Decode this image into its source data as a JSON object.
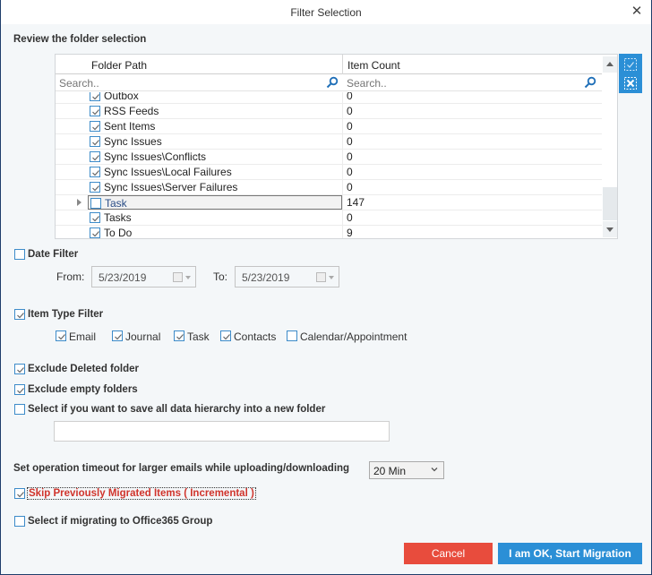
{
  "window": {
    "title": "Filter Selection",
    "close_icon": "close-icon"
  },
  "folder_review": {
    "section_label": "Review the folder selection",
    "columns": [
      "Folder Path",
      "Item Count"
    ],
    "search_placeholders": [
      "Search..",
      "Search.."
    ],
    "rows": [
      {
        "path": "Outbox",
        "count": "0",
        "checked": true,
        "partial": true
      },
      {
        "path": "RSS Feeds",
        "count": "0",
        "checked": true
      },
      {
        "path": "Sent Items",
        "count": "0",
        "checked": true
      },
      {
        "path": "Sync Issues",
        "count": "0",
        "checked": true
      },
      {
        "path": "Sync Issues\\Conflicts",
        "count": "0",
        "checked": true
      },
      {
        "path": "Sync Issues\\Local Failures",
        "count": "0",
        "checked": true
      },
      {
        "path": "Sync Issues\\Server Failures",
        "count": "0",
        "checked": true
      },
      {
        "path": "Task",
        "count": "147",
        "checked": false,
        "selected": true
      },
      {
        "path": "Tasks",
        "count": "0",
        "checked": true
      },
      {
        "path": "To Do",
        "count": "9",
        "checked": true
      }
    ],
    "side_buttons": [
      "select-all-icon",
      "deselect-all-icon"
    ]
  },
  "date_filter": {
    "label": "Date Filter",
    "checked": false,
    "from_label": "From:",
    "from_value": "5/23/2019",
    "to_label": "To:",
    "to_value": "5/23/2019"
  },
  "item_type_filter": {
    "label": "Item Type Filter",
    "checked": true,
    "types": [
      {
        "label": "Email",
        "checked": true
      },
      {
        "label": "Journal",
        "checked": true
      },
      {
        "label": "Task",
        "checked": true
      },
      {
        "label": "Contacts",
        "checked": true
      },
      {
        "label": "Calendar/Appointment",
        "checked": false
      }
    ]
  },
  "options": {
    "exclude_deleted": {
      "label": "Exclude Deleted folder",
      "checked": true
    },
    "exclude_empty": {
      "label": "Exclude empty folders",
      "checked": true
    },
    "save_hierarchy": {
      "label": "Select if you want to save all data hierarchy into a new folder",
      "checked": false,
      "folder_name_value": ""
    },
    "timeout_label": "Set operation timeout for larger emails while uploading/downloading",
    "timeout_value": "20 Min",
    "skip_incremental": {
      "label": "Skip Previously Migrated Items ( Incremental )",
      "checked": true
    },
    "office365_group": {
      "label": "Select if migrating to Office365 Group",
      "checked": false
    }
  },
  "buttons": {
    "cancel": "Cancel",
    "start": "I am OK, Start Migration"
  },
  "colors": {
    "accent": "#2b8fd6",
    "cancel": "#e84c3d",
    "incremental_text": "#d0342c",
    "window_border": "#1f3e6b"
  }
}
